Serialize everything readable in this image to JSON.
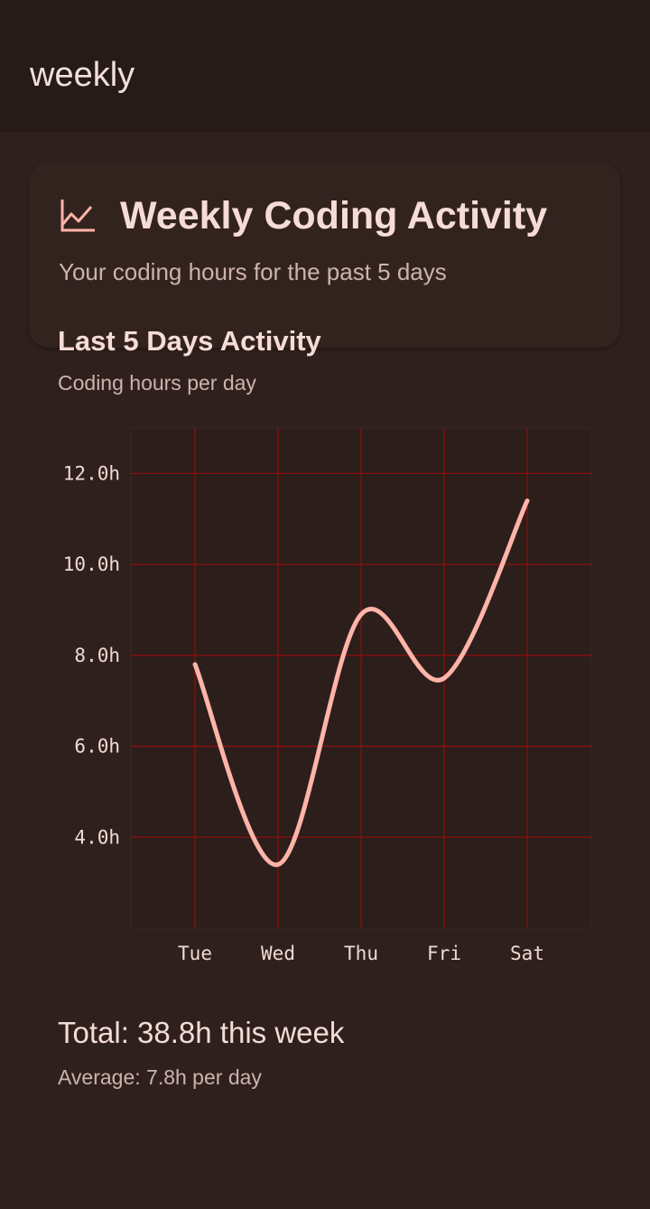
{
  "app": {
    "title": "weekly"
  },
  "card": {
    "icon": "line-chart-icon",
    "title": "Weekly Coding Activity",
    "subtitle": "Your coding hours for the past 5 days"
  },
  "section": {
    "title": "Last 5 Days Activity",
    "subtitle": "Coding hours per day"
  },
  "summary": {
    "total": "Total: 38.8h this week",
    "average": "Average: 7.8h per day"
  },
  "colors": {
    "background": "#30201d",
    "line": "#ffb4a8",
    "grid": "#8a1010"
  },
  "chart_data": {
    "type": "line",
    "categories": [
      "Tue",
      "Wed",
      "Thu",
      "Fri",
      "Sat"
    ],
    "values": [
      7.8,
      3.4,
      8.9,
      7.5,
      11.4
    ],
    "ylim": [
      2.0,
      13.0
    ],
    "yticks": [
      4.0,
      6.0,
      8.0,
      10.0,
      12.0
    ],
    "ytick_labels": [
      "4.0h",
      "6.0h",
      "8.0h",
      "10.0h",
      "12.0h"
    ],
    "grid": true,
    "smooth": true
  }
}
